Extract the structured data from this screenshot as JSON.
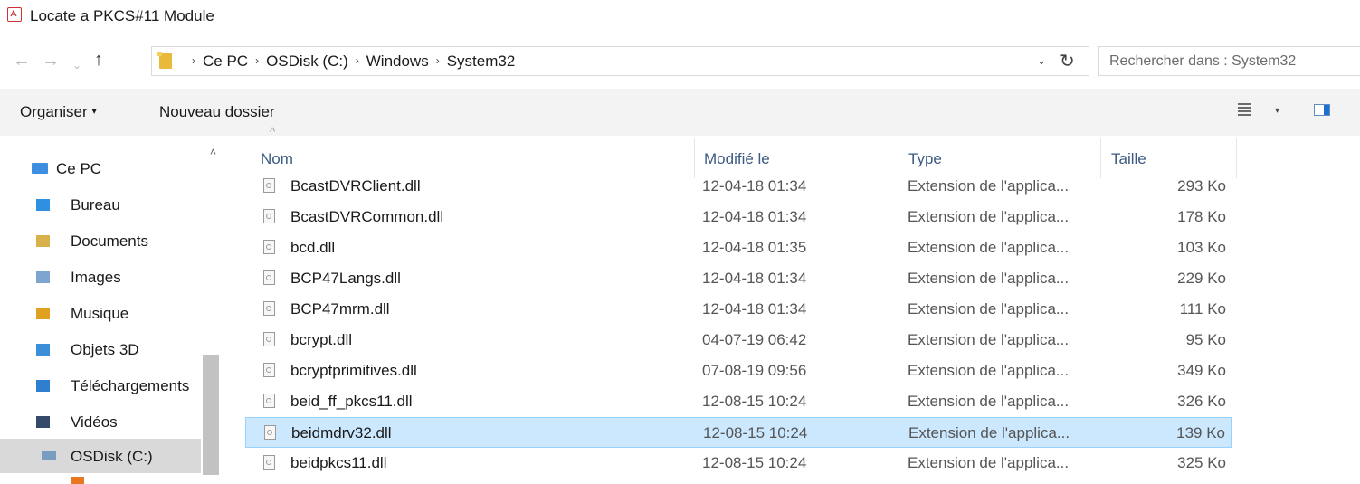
{
  "window": {
    "title": "Locate a PKCS#11 Module"
  },
  "navigation": {
    "back_glyph": "←",
    "forward_glyph": "→",
    "recent_glyph": "⌄",
    "up_glyph": "↑",
    "breadcrumbs": [
      "Ce PC",
      "OSDisk (C:)",
      "Windows",
      "System32"
    ],
    "crumb_separator": "›",
    "dropdown_glyph": "⌄",
    "refresh_glyph": "↻",
    "search_placeholder": "Rechercher dans : System32"
  },
  "toolbar": {
    "organise_label": "Organiser",
    "organise_caret": "▾",
    "new_folder_label": "Nouveau dossier",
    "view_caret": "▾"
  },
  "sidebar": {
    "scroll_up_glyph": "˄",
    "items": [
      {
        "label": "Ce PC",
        "icon": "computer-icon",
        "color": "#3d8ee0"
      },
      {
        "label": "Bureau",
        "icon": "desktop-folder-icon",
        "color": "#2f8fe0"
      },
      {
        "label": "Documents",
        "icon": "documents-folder-icon",
        "color": "#d9b14a"
      },
      {
        "label": "Images",
        "icon": "pictures-folder-icon",
        "color": "#7ca6d0"
      },
      {
        "label": "Musique",
        "icon": "music-folder-icon",
        "color": "#e0a020"
      },
      {
        "label": "Objets 3D",
        "icon": "3d-objects-folder-icon",
        "color": "#3a8fd8"
      },
      {
        "label": "Téléchargements",
        "icon": "downloads-folder-icon",
        "color": "#2f7fd0"
      },
      {
        "label": "Vidéos",
        "icon": "videos-folder-icon",
        "color": "#354a6a"
      },
      {
        "label": "OSDisk (C:)",
        "icon": "drive-icon",
        "color": "#7a9cc0"
      }
    ]
  },
  "file_list": {
    "columns": {
      "name": "Nom",
      "modified": "Modifié le",
      "type": "Type",
      "size": "Taille"
    },
    "sort_glyph": "^",
    "selected_index": 8,
    "rows": [
      {
        "name": "BcastDVRClient.dll",
        "modified": "12-04-18 01:34",
        "type": "Extension de l'applica...",
        "size": "293 Ko"
      },
      {
        "name": "BcastDVRCommon.dll",
        "modified": "12-04-18 01:34",
        "type": "Extension de l'applica...",
        "size": "178 Ko"
      },
      {
        "name": "bcd.dll",
        "modified": "12-04-18 01:35",
        "type": "Extension de l'applica...",
        "size": "103 Ko"
      },
      {
        "name": "BCP47Langs.dll",
        "modified": "12-04-18 01:34",
        "type": "Extension de l'applica...",
        "size": "229 Ko"
      },
      {
        "name": "BCP47mrm.dll",
        "modified": "12-04-18 01:34",
        "type": "Extension de l'applica...",
        "size": "111 Ko"
      },
      {
        "name": "bcrypt.dll",
        "modified": "04-07-19 06:42",
        "type": "Extension de l'applica...",
        "size": "95 Ko"
      },
      {
        "name": "bcryptprimitives.dll",
        "modified": "07-08-19 09:56",
        "type": "Extension de l'applica...",
        "size": "349 Ko"
      },
      {
        "name": "beid_ff_pkcs11.dll",
        "modified": "12-08-15 10:24",
        "type": "Extension de l'applica...",
        "size": "326 Ko"
      },
      {
        "name": "beidmdrv32.dll",
        "modified": "12-08-15 10:24",
        "type": "Extension de l'applica...",
        "size": "139 Ko"
      },
      {
        "name": "beidpkcs11.dll",
        "modified": "12-08-15 10:24",
        "type": "Extension de l'applica...",
        "size": "325 Ko"
      }
    ]
  }
}
